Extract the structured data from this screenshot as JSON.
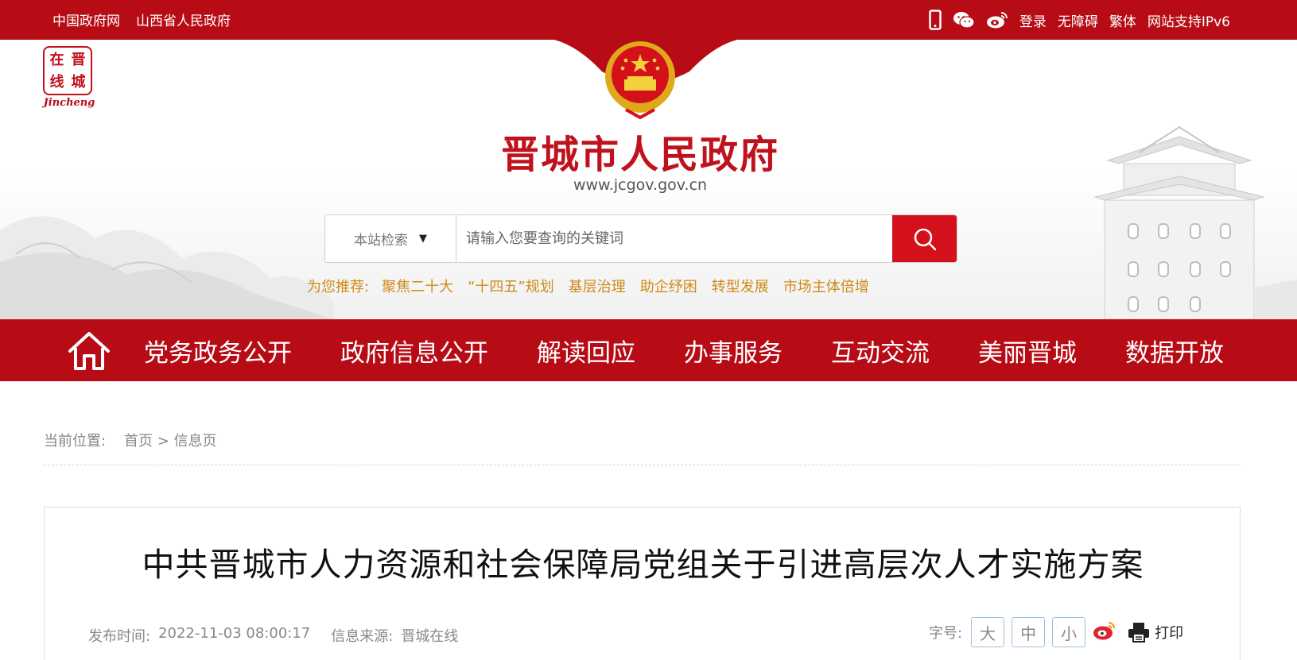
{
  "topbar": {
    "links": [
      "中国政府网",
      "山西省人民政府"
    ],
    "right": {
      "login": "登录",
      "accessibility": "无障碍",
      "traditional": "繁体",
      "ipv6": "网站支持IPv6"
    },
    "icons": [
      "mobile-icon",
      "wechat-icon",
      "weibo-icon"
    ]
  },
  "logo": {
    "seal_chars": [
      "在",
      "晋",
      "线",
      "城"
    ],
    "latin": "Jincheng"
  },
  "header": {
    "title": "晋城市人民政府",
    "url": "www.jcgov.gov.cn"
  },
  "search": {
    "scope": "本站检索",
    "placeholder": "请输入您要查询的关键词"
  },
  "recommend": {
    "label": "为您推荐:",
    "keywords": [
      "聚焦二十大",
      "“十四五”规划",
      "基层治理",
      "助企纾困",
      "转型发展",
      "市场主体倍增"
    ]
  },
  "nav": {
    "items": [
      "党务政务公开",
      "政府信息公开",
      "解读回应",
      "办事服务",
      "互动交流",
      "美丽晋城",
      "数据开放"
    ]
  },
  "breadcrumb": {
    "label": "当前位置:",
    "home": "首页",
    "sep": ">",
    "current": "信息页"
  },
  "article": {
    "title": "中共晋城市人力资源和社会保障局党组关于引进高层次人才实施方案",
    "publish_label": "发布时间:",
    "publish_time": "2022-11-03 08:00:17",
    "source_label": "信息来源:",
    "source": "晋城在线",
    "fontsize_label": "字号:",
    "font_sizes": [
      "大",
      "中",
      "小"
    ],
    "print": "打印"
  },
  "colors": {
    "brand_red": "#b70b15",
    "search_red": "#d4101a",
    "recommend_orange": "#cf8a17"
  }
}
